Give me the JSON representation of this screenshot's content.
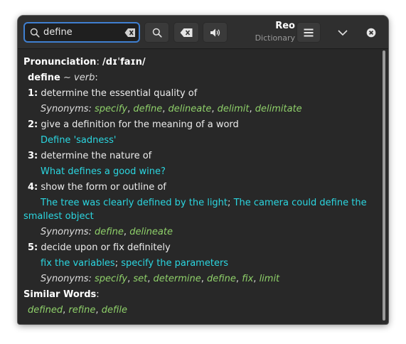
{
  "app": {
    "title": "Reo",
    "subtitle": "Dictionary"
  },
  "search": {
    "value": "define",
    "placeholder": ""
  },
  "icons": {
    "search": "search-icon",
    "clear": "clear-text-icon",
    "lookup": "search-icon",
    "backspace": "backspace-icon",
    "speak": "speaker-icon",
    "menu": "hamburger-menu-icon",
    "minimize": "chevron-down-icon",
    "close": "close-icon"
  },
  "colors": {
    "accent": "#3f7fd0",
    "example": "#2bd6e0",
    "synonym": "#8fd16a",
    "background": "#282828"
  },
  "definition": {
    "pronunciation_label": "Pronunciation",
    "pronunciation_colon": ":",
    "pronunciation_ipa": "/dɪˈfaɪn/",
    "word": "define",
    "pos_sep": "~",
    "pos": "verb",
    "pos_colon": ":",
    "senses": [
      {
        "num": "1:",
        "text": "determine the essential quality of",
        "synonyms_label": "Synonyms:",
        "synonyms": [
          "specify",
          "define",
          "delineate",
          "delimit",
          "delimitate"
        ]
      },
      {
        "num": "2:",
        "text": "give a definition for the meaning of a word",
        "example": "Define 'sadness'"
      },
      {
        "num": "3:",
        "text": "determine the nature of",
        "example": "What defines a good wine?"
      },
      {
        "num": "4:",
        "text": "show the form or outline of",
        "example_a": "The tree was clearly defined by the light",
        "example_sep": ";",
        "example_b_part1": "The camera could define the",
        "example_b_part2": "smallest object",
        "synonyms_label": "Synonyms:",
        "synonyms": [
          "define",
          "delineate"
        ]
      },
      {
        "num": "5:",
        "text": "decide upon or fix definitely",
        "example_a": "fix the variables",
        "example_sep": ";",
        "example_b": "specify the parameters",
        "synonyms_label": "Synonyms:",
        "synonyms": [
          "specify",
          "set",
          "determine",
          "define",
          "fix",
          "limit"
        ]
      }
    ],
    "similar_label": "Similar Words",
    "similar_colon": ":",
    "similar_words": [
      "defined",
      "refine",
      "defile"
    ],
    "comma": ","
  }
}
